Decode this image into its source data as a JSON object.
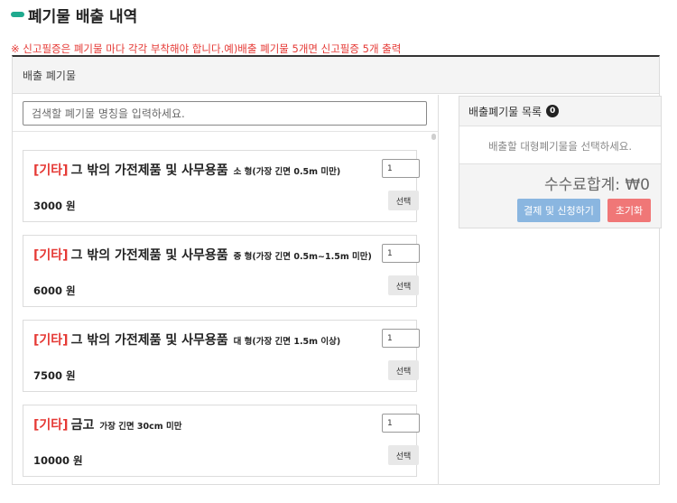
{
  "header": {
    "title": "폐기물 배출 내역",
    "notice": "※ 신고필증은 폐기물 마다 각각 부착해야 합니다.예)배출 폐기물 5개면 신고필증 5개 출력"
  },
  "panel": {
    "heading": "배출 폐기물"
  },
  "search": {
    "placeholder": "검색할 폐기물 명칭을 입력하세요."
  },
  "items": [
    {
      "category": "[기타]",
      "name": "그 밖의 가전제품 및 사무용품",
      "size": "소 형(가장 긴면 0.5m 미만)",
      "qty": "1",
      "price": "3000 원",
      "select_label": "선택"
    },
    {
      "category": "[기타]",
      "name": "그 밖의 가전제품 및 사무용품",
      "size": "중 형(가장 긴면 0.5m~1.5m 미만)",
      "qty": "1",
      "price": "6000 원",
      "select_label": "선택"
    },
    {
      "category": "[기타]",
      "name": "그 밖의 가전제품 및 사무용품",
      "size": "대 형(가장 긴면 1.5m 이상)",
      "qty": "1",
      "price": "7500 원",
      "select_label": "선택"
    },
    {
      "category": "[기타]",
      "name": "금고",
      "size": "가장 긴면 30cm 미만",
      "qty": "1",
      "price": "10000 원",
      "select_label": "선택"
    }
  ],
  "cart": {
    "title": "배출폐기물 목록",
    "count": "0",
    "empty_message": "배출할 대형폐기물을 선택하세요.",
    "total": "수수료합계: ₩0",
    "pay_label": "결제 및 신청하기",
    "reset_label": "초기화"
  },
  "colors": {
    "accent": "#1faa8f",
    "category_red": "#e53935",
    "pay_button": "#8ab6e0",
    "reset_button": "#f07777"
  }
}
